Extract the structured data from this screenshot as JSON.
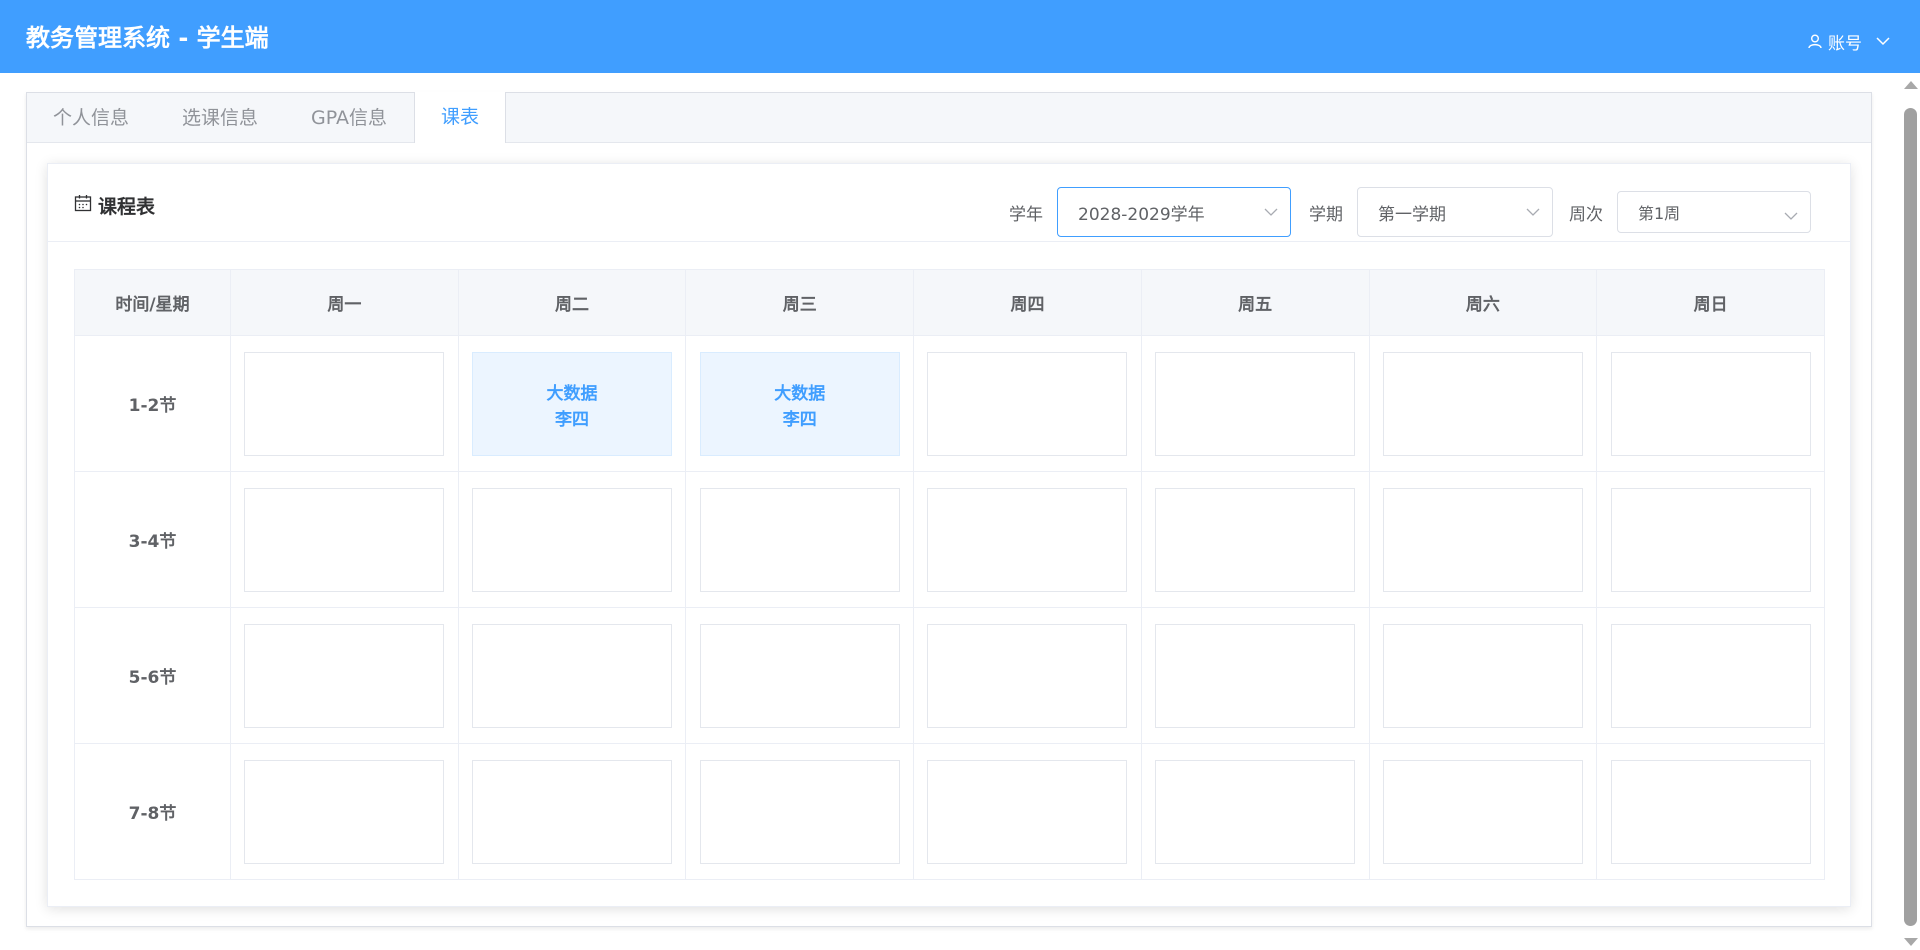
{
  "header": {
    "title": "教务管理系统 - 学生端",
    "account_label": "账号"
  },
  "tabs": [
    {
      "label": "个人信息",
      "active": false
    },
    {
      "label": "选课信息",
      "active": false
    },
    {
      "label": "GPA信息",
      "active": false
    },
    {
      "label": "课表",
      "active": true
    }
  ],
  "card": {
    "title": "课程表"
  },
  "filters": {
    "year_label": "学年",
    "year_value": "2028-2029学年",
    "term_label": "学期",
    "term_value": "第一学期",
    "week_label": "周次",
    "week_value": "第1周"
  },
  "table": {
    "corner_header": "时间/星期",
    "days": [
      "周一",
      "周二",
      "周三",
      "周四",
      "周五",
      "周六",
      "周日"
    ],
    "periods": [
      {
        "label": "1-2节",
        "courses": [
          null,
          {
            "name": "大数据",
            "teacher": "李四"
          },
          {
            "name": "大数据",
            "teacher": "李四"
          },
          null,
          null,
          null,
          null
        ]
      },
      {
        "label": "3-4节",
        "courses": [
          null,
          null,
          null,
          null,
          null,
          null,
          null
        ]
      },
      {
        "label": "5-6节",
        "courses": [
          null,
          null,
          null,
          null,
          null,
          null,
          null
        ]
      },
      {
        "label": "7-8节",
        "courses": [
          null,
          null,
          null,
          null,
          null,
          null,
          null
        ]
      }
    ]
  },
  "colors": {
    "primary": "#409EFF",
    "course_bg": "#ecf5ff"
  },
  "icons": {
    "account": "user-icon",
    "dropdown": "chevron-down-icon",
    "calendar": "calendar-icon"
  }
}
